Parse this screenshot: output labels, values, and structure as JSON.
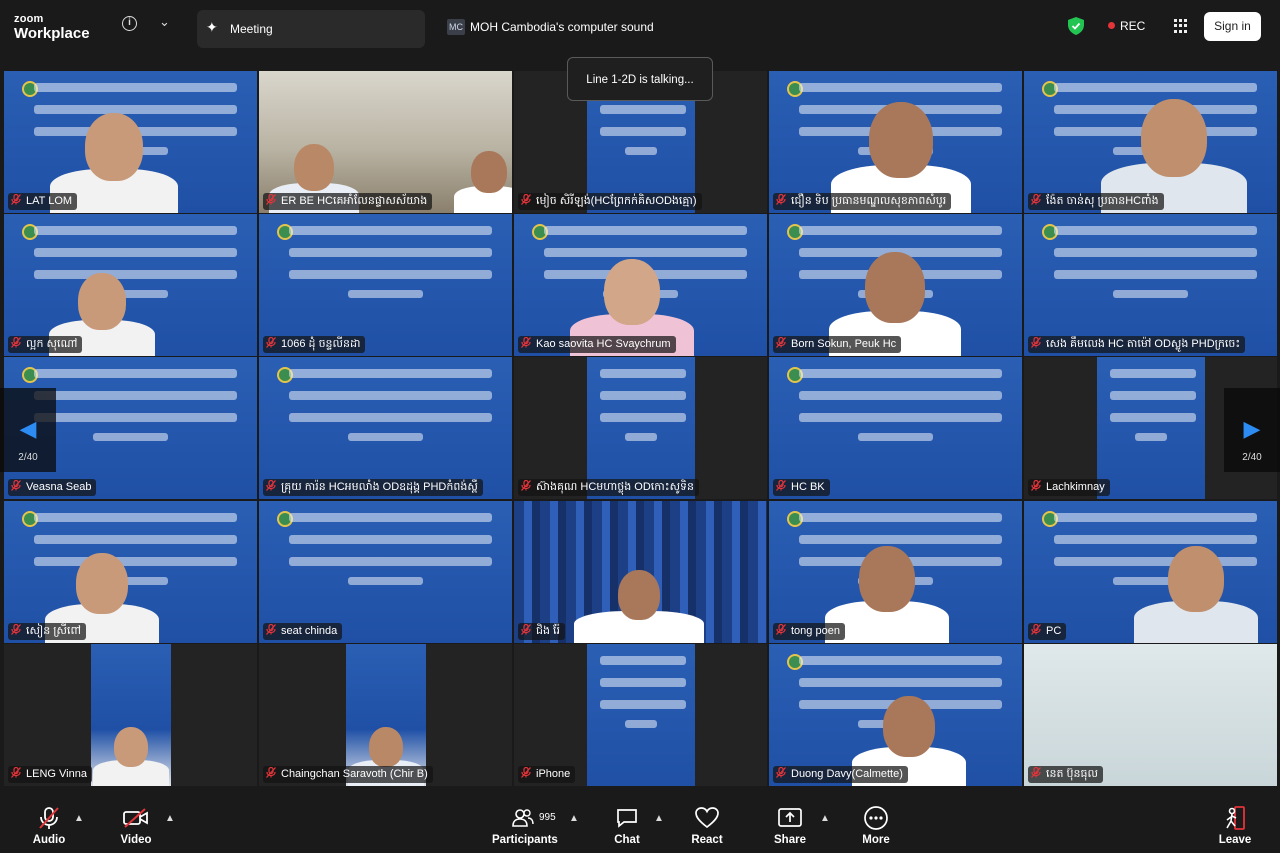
{
  "app": {
    "logo_line1": "zoom",
    "logo_line2": "Workplace"
  },
  "header": {
    "meeting_tab": "Meeting",
    "sound_badge": "MC",
    "sound_text": "MOH Cambodia's computer sound",
    "rec_label": "REC",
    "signin_label": "Sign in",
    "accent": "#2c8cf4",
    "rec_color": "#e3343a",
    "shield_color": "#23c552"
  },
  "talking": "Line 1-2D is talking...",
  "pager": {
    "left": "2/40",
    "right": "2/40"
  },
  "participants": [
    {
      "name": "LAT LOM",
      "type": "slide-person"
    },
    {
      "name": "ER BE HCគេអាំលែនផ្ទាសស័យាង",
      "type": "office"
    },
    {
      "name": "មៀច សិរីឡង់(HCព្រែកក់គិសODងគ្មោ)",
      "type": "slide-narrow"
    },
    {
      "name": "ជឿន ទិប ប្រធានមណ្ឌលសុខភាពសំបូរ",
      "type": "slide-person"
    },
    {
      "name": "ង៉ែត ចាន់សុ ប្រធានHCពាំង",
      "type": "slide-person"
    },
    {
      "name": "ល្អក សុណៅ",
      "type": "slide-person"
    },
    {
      "name": "1066 ដុំ ចន្ទលីនដា",
      "type": "slide"
    },
    {
      "name": "Kao saovita HC Svaychrum",
      "type": "slide-person"
    },
    {
      "name": "Born Sokun, Peuk Hc",
      "type": "slide-person"
    },
    {
      "name": "សេង គឹមលេង HC តាម៉ៅ ODស្លូង PHDក្រចេះ",
      "type": "slide"
    },
    {
      "name": "Veasna Seab",
      "type": "slide"
    },
    {
      "name": "គ្រុយ ការ៉ន HCអមលាំង ODឧដុង្គ PHDកំពង់ស្ពឺ",
      "type": "slide"
    },
    {
      "name": "ស៊ាងគុណ HCមហាថ្លុង ODកោះសូទិន",
      "type": "slide-narrow"
    },
    {
      "name": "HC BK",
      "type": "slide"
    },
    {
      "name": "Lachkimnay",
      "type": "slide-narrow"
    },
    {
      "name": "សៀន ស្រីពៅ",
      "type": "slide-person"
    },
    {
      "name": "seat chinda",
      "type": "slide"
    },
    {
      "name": "ជិង រ៉ែ",
      "type": "curtain"
    },
    {
      "name": "tong poen",
      "type": "slide-person"
    },
    {
      "name": "PC",
      "type": "slide-person"
    },
    {
      "name": "LENG Vinna",
      "type": "narrow-person"
    },
    {
      "name": "Chaingchan Saravoth (Chir B)",
      "type": "narrow-person"
    },
    {
      "name": "iPhone",
      "type": "slide-narrow"
    },
    {
      "name": "Duong Davy(Calmette)",
      "type": "slide-person"
    },
    {
      "name": "នេត ប៊ុនធុល",
      "type": "wall"
    }
  ],
  "toolbar": {
    "audio": "Audio",
    "video": "Video",
    "participants": "Participants",
    "participants_count": "995",
    "chat": "Chat",
    "react": "React",
    "share": "Share",
    "more": "More",
    "leave": "Leave"
  }
}
